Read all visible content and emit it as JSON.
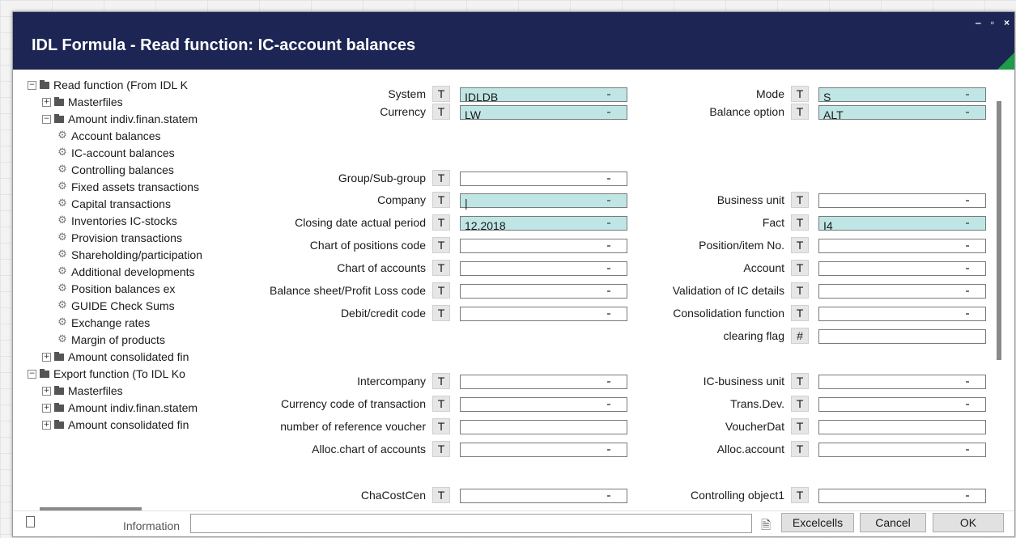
{
  "window": {
    "title": "IDL Formula - Read function: IC-account balances",
    "minimize": "‒",
    "maximize": "▫",
    "close": "×"
  },
  "tree": [
    {
      "label": "Read function (From IDL K",
      "toggle": "−",
      "kind": "folder"
    },
    {
      "label": "Masterfiles",
      "toggle": "+",
      "kind": "folder"
    },
    {
      "label": "Amount indiv.finan.statem",
      "toggle": "−",
      "kind": "folder"
    },
    {
      "label": "Account balances",
      "kind": "leaf"
    },
    {
      "label": "IC-account balances",
      "kind": "leaf"
    },
    {
      "label": "Controlling balances",
      "kind": "leaf"
    },
    {
      "label": "Fixed assets transactions",
      "kind": "leaf"
    },
    {
      "label": "Capital transactions",
      "kind": "leaf"
    },
    {
      "label": "Inventories IC-stocks",
      "kind": "leaf"
    },
    {
      "label": "Provision transactions",
      "kind": "leaf"
    },
    {
      "label": "Shareholding/participation",
      "kind": "leaf"
    },
    {
      "label": "Additional developments",
      "kind": "leaf"
    },
    {
      "label": "Position balances ex",
      "kind": "leaf"
    },
    {
      "label": "GUIDE Check Sums",
      "kind": "leaf"
    },
    {
      "label": "Exchange rates",
      "kind": "leaf"
    },
    {
      "label": "Margin of products",
      "kind": "leaf"
    },
    {
      "label": "Amount consolidated fin",
      "toggle": "+",
      "kind": "folder"
    },
    {
      "label": "Export function (To IDL Ko",
      "toggle": "−",
      "kind": "folder"
    },
    {
      "label": "Masterfiles",
      "toggle": "+",
      "kind": "folder"
    },
    {
      "label": "Amount indiv.finan.statem",
      "toggle": "+",
      "kind": "folder"
    },
    {
      "label": "Amount consolidated fin",
      "toggle": "+",
      "kind": "folder"
    }
  ],
  "fields_left": [
    {
      "label": "System",
      "btn": "T",
      "value": "IDLDB",
      "highlight": true,
      "dropdown": true
    },
    {
      "label": "Currency",
      "btn": "T",
      "value": "LW",
      "highlight": true,
      "dropdown": true
    },
    {
      "label": "Group/Sub-group",
      "btn": "T",
      "value": "",
      "highlight": false,
      "dropdown": true
    },
    {
      "label": "Company",
      "btn": "T",
      "value": "|",
      "highlight": true,
      "dropdown": true
    },
    {
      "label": "Closing date actual period",
      "btn": "T",
      "value": "12.2018",
      "highlight": true,
      "dropdown": true
    },
    {
      "label": "Chart of positions code",
      "btn": "T",
      "value": "",
      "highlight": false,
      "dropdown": true
    },
    {
      "label": "Chart of accounts",
      "btn": "T",
      "value": "",
      "highlight": false,
      "dropdown": true
    },
    {
      "label": "Balance sheet/Profit  Loss code",
      "btn": "T",
      "value": "",
      "highlight": false,
      "dropdown": true
    },
    {
      "label": "Debit/credit code",
      "btn": "T",
      "value": "",
      "highlight": false,
      "dropdown": true
    },
    {
      "label": "Intercompany",
      "btn": "T",
      "value": "",
      "highlight": false,
      "dropdown": true
    },
    {
      "label": "Currency code of transaction",
      "btn": "T",
      "value": "",
      "highlight": false,
      "dropdown": true
    },
    {
      "label": "number of reference voucher",
      "btn": "T",
      "value": "",
      "highlight": false,
      "dropdown": false
    },
    {
      "label": "Alloc.chart of accounts",
      "btn": "T",
      "value": "",
      "highlight": false,
      "dropdown": true
    },
    {
      "label": "ChaCostCen",
      "btn": "T",
      "value": "",
      "highlight": false,
      "dropdown": true
    }
  ],
  "fields_right": [
    {
      "label": "Mode",
      "btn": "T",
      "value": "S",
      "highlight": true,
      "dropdown": true
    },
    {
      "label": "Balance option",
      "btn": "T",
      "value": "ALT",
      "highlight": true,
      "dropdown": true
    },
    {
      "label": "Business unit",
      "btn": "T",
      "value": "",
      "highlight": false,
      "dropdown": true
    },
    {
      "label": "Fact",
      "btn": "T",
      "value": "I4",
      "highlight": true,
      "dropdown": true
    },
    {
      "label": "Position/item No.",
      "btn": "T",
      "value": "",
      "highlight": false,
      "dropdown": true
    },
    {
      "label": "Account",
      "btn": "T",
      "value": "",
      "highlight": false,
      "dropdown": true
    },
    {
      "label": "Validation of IC details",
      "btn": "T",
      "value": "",
      "highlight": false,
      "dropdown": true
    },
    {
      "label": "Consolidation function",
      "btn": "T",
      "value": "",
      "highlight": false,
      "dropdown": true
    },
    {
      "label": "clearing flag",
      "btn": "#",
      "value": "",
      "highlight": false,
      "dropdown": false
    },
    {
      "label": "IC-business unit",
      "btn": "T",
      "value": "",
      "highlight": false,
      "dropdown": true
    },
    {
      "label": "Trans.Dev.",
      "btn": "T",
      "value": "",
      "highlight": false,
      "dropdown": true
    },
    {
      "label": "VoucherDat",
      "btn": "T",
      "value": "",
      "highlight": false,
      "dropdown": false
    },
    {
      "label": "Alloc.account",
      "btn": "T",
      "value": "",
      "highlight": false,
      "dropdown": true
    },
    {
      "label": "Controlling object1",
      "btn": "T",
      "value": "",
      "highlight": false,
      "dropdown": true
    }
  ],
  "footer": {
    "information_label": "Information",
    "information_value": "",
    "excelcells": "Excelcells",
    "cancel": "Cancel",
    "ok": "OK"
  },
  "icons": {
    "sidebar_toggle": "panel-icon",
    "export": "document-export-icon",
    "settings": "gear-icon"
  }
}
